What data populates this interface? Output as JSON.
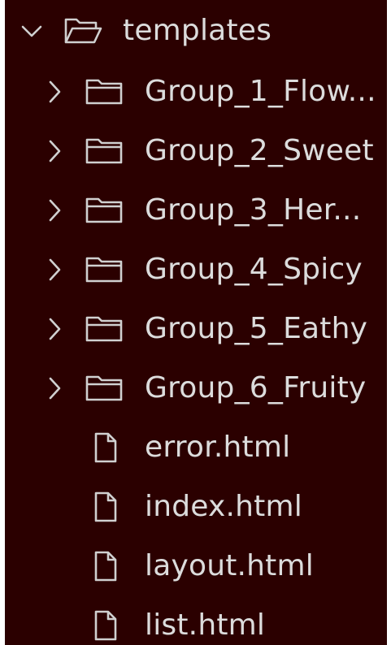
{
  "explorer": {
    "root": {
      "label": "templates",
      "expanded": true,
      "twistie_icon": "chevron-down-icon",
      "icon": "folder-open-icon"
    },
    "folders": [
      {
        "label": "Group_1_Flow...",
        "twistie_icon": "chevron-right-icon",
        "icon": "folder-icon"
      },
      {
        "label": "Group_2_Sweet",
        "twistie_icon": "chevron-right-icon",
        "icon": "folder-icon"
      },
      {
        "label": "Group_3_Her...",
        "twistie_icon": "chevron-right-icon",
        "icon": "folder-icon"
      },
      {
        "label": "Group_4_Spicy",
        "twistie_icon": "chevron-right-icon",
        "icon": "folder-icon"
      },
      {
        "label": "Group_5_Eathy",
        "twistie_icon": "chevron-right-icon",
        "icon": "folder-icon"
      },
      {
        "label": "Group_6_Fruity",
        "twistie_icon": "chevron-right-icon",
        "icon": "folder-icon"
      }
    ],
    "files": [
      {
        "label": "error.html",
        "icon": "file-icon"
      },
      {
        "label": "index.html",
        "icon": "file-icon"
      },
      {
        "label": "layout.html",
        "icon": "file-icon"
      },
      {
        "label": "list.html",
        "icon": "file-icon"
      }
    ],
    "colors": {
      "background": "#2b0000",
      "text": "#dcdcdc",
      "icon": "#d0d0d0"
    }
  }
}
